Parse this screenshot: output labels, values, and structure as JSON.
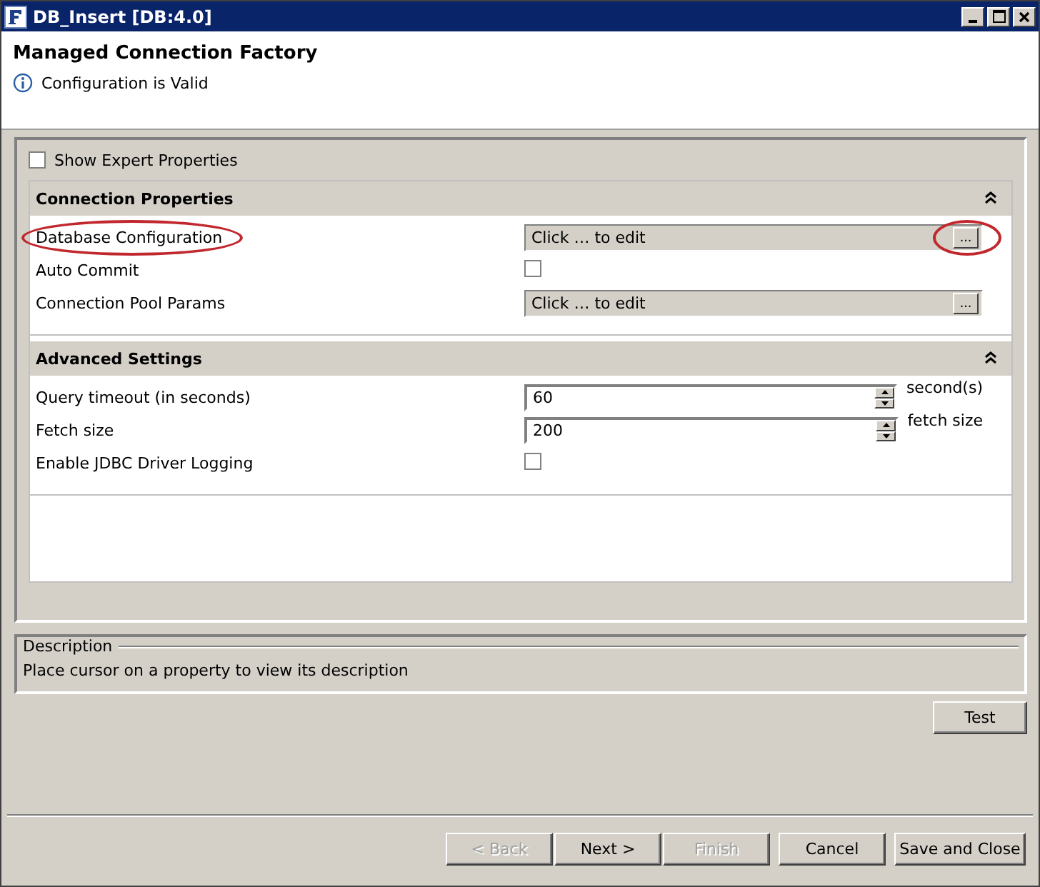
{
  "window": {
    "title": "DB_Insert [DB:4.0]"
  },
  "header": {
    "title": "Managed Connection Factory",
    "message": "Configuration is Valid"
  },
  "show_expert_properties": {
    "label": "Show Expert Properties",
    "checked": false
  },
  "sections": [
    {
      "title": "Connection Properties",
      "expanded": true,
      "rows": [
        {
          "kind": "editor",
          "label": "Database Configuration",
          "value": "Click … to edit",
          "button": "...",
          "label_circled": true,
          "button_circled": true
        },
        {
          "kind": "checkbox",
          "label": "Auto Commit",
          "checked": false
        },
        {
          "kind": "editor",
          "label": "Connection Pool Params",
          "value": "Click … to edit",
          "button": "...",
          "label_circled": false,
          "button_circled": false
        }
      ]
    },
    {
      "title": "Advanced Settings",
      "expanded": true,
      "rows": [
        {
          "kind": "spinner",
          "label": "Query timeout (in seconds)",
          "value": "60",
          "unit": "second(s)"
        },
        {
          "kind": "spinner",
          "label": "Fetch size",
          "value": "200",
          "unit": "fetch size"
        },
        {
          "kind": "checkbox",
          "label": "Enable JDBC Driver Logging",
          "checked": false
        }
      ]
    }
  ],
  "description": {
    "title": "Description",
    "text": "Place cursor on a property to view its description"
  },
  "test_button": {
    "label": "Test"
  },
  "buttons": [
    {
      "label": "< Back",
      "disabled": true
    },
    {
      "label": "Next >",
      "disabled": false
    },
    {
      "label": "Finish",
      "disabled": true
    },
    {
      "label": "Cancel",
      "disabled": false
    },
    {
      "label": "Save and Close",
      "disabled": false
    }
  ]
}
